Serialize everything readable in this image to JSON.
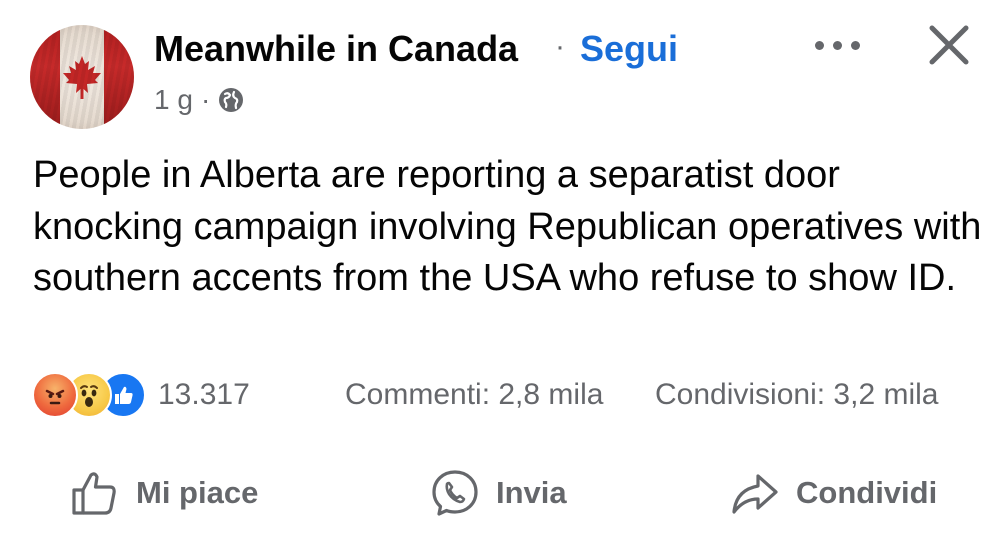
{
  "post": {
    "page_name": "Meanwhile in Canada",
    "separator": "·",
    "follow_label": "Segui",
    "time": "1 g",
    "meta_separator": "·",
    "audience_icon": "globe-icon",
    "more_icon": "more-options-icon",
    "close_icon": "close-icon",
    "text": "People in Alberta are reporting a separatist door knocking campaign involving Republican operatives with southern accents from the USA who refuse to show ID."
  },
  "stats": {
    "reaction_icons": [
      "angry-reaction-icon",
      "wow-reaction-icon",
      "like-reaction-icon"
    ],
    "reaction_count": "13.317",
    "comments": "Commenti: 2,8 mila",
    "shares": "Condivisioni: 3,2 mila"
  },
  "actions": {
    "like_label": "Mi piace",
    "send_label": "Invia",
    "share_label": "Condividi"
  },
  "colors": {
    "follow_blue": "#1a6ed8",
    "secondary_text": "#65676b",
    "like_blue": "#1877f2",
    "flag_red": "#c72a2a"
  }
}
